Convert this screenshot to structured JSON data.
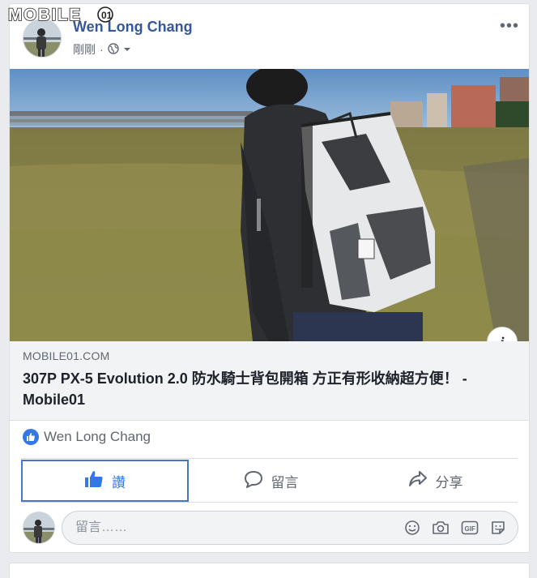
{
  "watermark": {
    "text": "MOBILE01"
  },
  "post": {
    "author": "Wen Long Chang",
    "time": "剛剛",
    "separator": "·",
    "audience_icon": "globe-icon",
    "menu_icon": "more-icon",
    "more_label": "•••"
  },
  "link_preview": {
    "domain": "MOBILE01.COM",
    "title": "307P PX-5 Evolution 2.0 防水騎士背包開箱 方正有形收納超方便！ - Mobile01",
    "info_label": "i"
  },
  "reactions": {
    "icon": "thumbs-up-icon",
    "names": "Wen Long Chang"
  },
  "actions": [
    {
      "label": "讚",
      "icon": "thumbs-up-icon",
      "active": true
    },
    {
      "label": "留言",
      "icon": "comment-icon",
      "active": false
    },
    {
      "label": "分享",
      "icon": "share-icon",
      "active": false
    }
  ],
  "comment_box": {
    "placeholder": "留言……",
    "tools": [
      "emoji-icon",
      "camera-icon",
      "gif-icon",
      "sticker-icon"
    ]
  },
  "colors": {
    "author": "#365899",
    "like_blue": "#3578e5",
    "liked_border": "#4a76c8",
    "background": "#e9ebee"
  }
}
